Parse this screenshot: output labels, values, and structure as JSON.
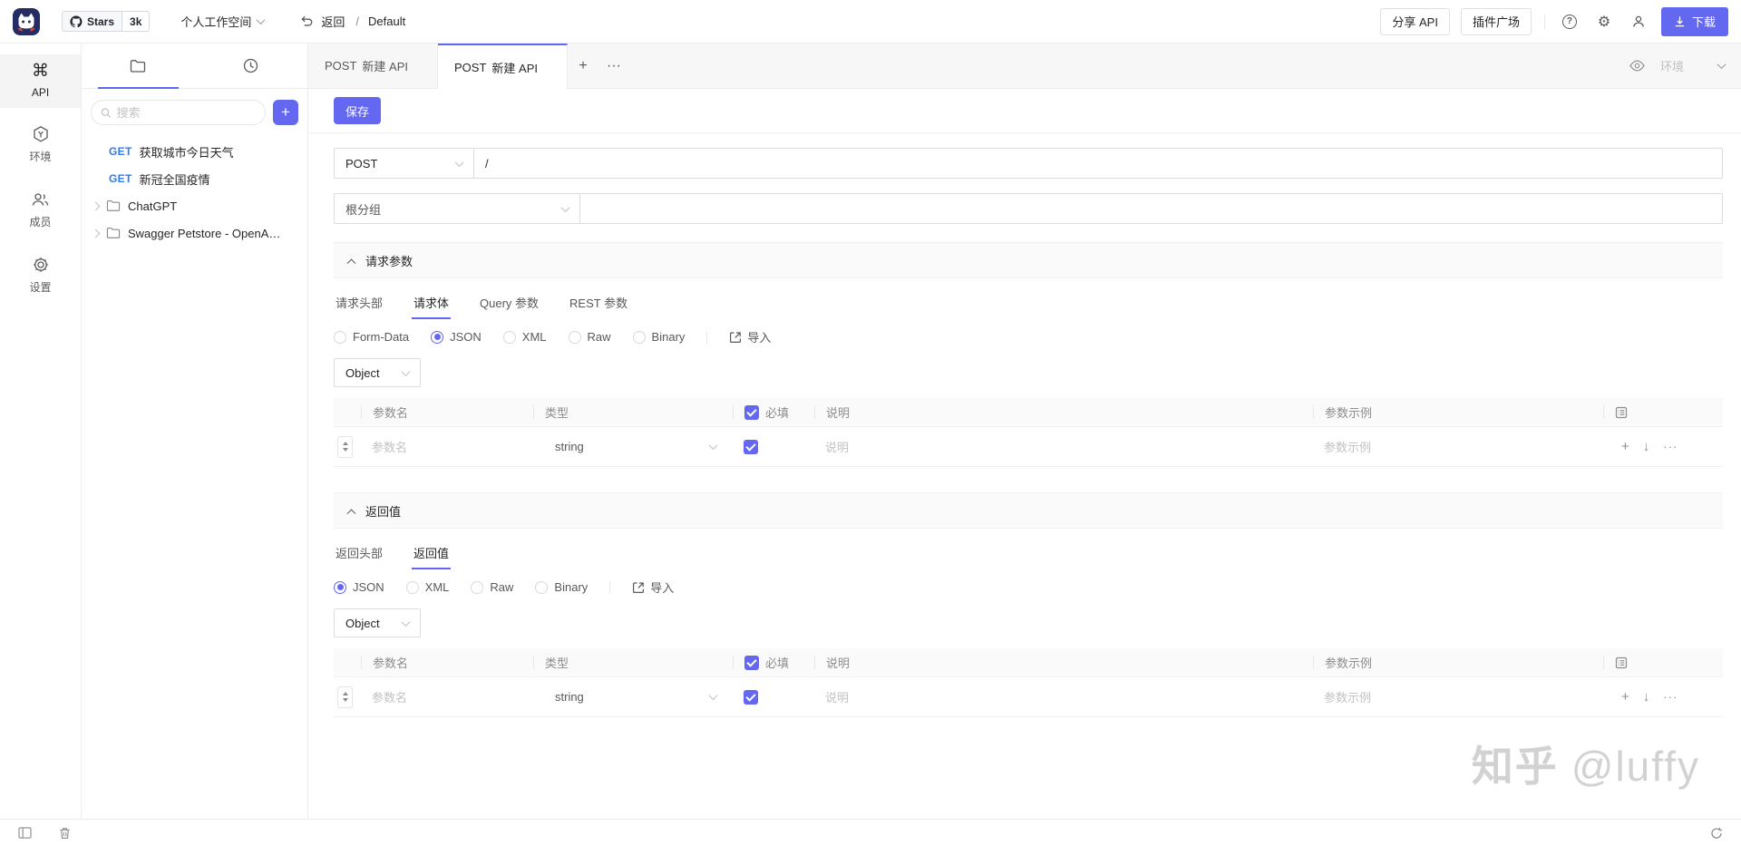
{
  "accent_color": "#6467ef",
  "get_color": "#2d7bf7",
  "topbar": {
    "stars_label": "Stars",
    "stars_count": "3k",
    "workspace": "个人工作空间",
    "back_label": "返回",
    "path_separator": "/",
    "project_name": "Default",
    "share_api_label": "分享 API",
    "plugin_market_label": "插件广场",
    "download_label": "下载"
  },
  "rail": {
    "items": [
      {
        "label": "API"
      },
      {
        "label": "环境"
      },
      {
        "label": "成员"
      },
      {
        "label": "设置"
      }
    ]
  },
  "sidebar": {
    "search_placeholder": "搜索",
    "add_button_label": "+",
    "items": [
      {
        "method": "GET",
        "name": "获取城市今日天气"
      },
      {
        "method": "GET",
        "name": "新冠全国疫情"
      },
      {
        "type": "folder",
        "name": "ChatGPT"
      },
      {
        "type": "folder",
        "name": "Swagger Petstore - OpenAPI ..."
      }
    ]
  },
  "tabbar": {
    "tabs": [
      {
        "method": "POST",
        "name": "新建 API"
      },
      {
        "method": "POST",
        "name": "新建 API"
      }
    ],
    "add_label": "+",
    "more_label": "···",
    "env_label": "环境"
  },
  "editor": {
    "save_label": "保存",
    "method_value": "POST",
    "url_value": "/",
    "group_value": "根分组",
    "request": {
      "title": "请求参数",
      "tabs": [
        "请求头部",
        "请求体",
        "Query 参数",
        "REST 参数"
      ],
      "active_tab": "请求体",
      "body_types": [
        "Form-Data",
        "JSON",
        "XML",
        "Raw",
        "Binary"
      ],
      "selected_type": "JSON",
      "import_label": "导入",
      "root_type": "Object"
    },
    "response": {
      "title": "返回值",
      "tabs": [
        "返回头部",
        "返回值"
      ],
      "active_tab": "返回值",
      "body_types": [
        "JSON",
        "XML",
        "Raw",
        "Binary"
      ],
      "selected_type": "JSON",
      "import_label": "导入",
      "root_type": "Object"
    },
    "param_table": {
      "headers": {
        "name": "参数名",
        "type": "类型",
        "required": "必填",
        "description": "说明",
        "example": "参数示例"
      },
      "row": {
        "name_placeholder": "参数名",
        "type_value": "string",
        "required": true,
        "description_placeholder": "说明",
        "example_placeholder": "参数示例",
        "actions": [
          "+",
          "↓",
          "···"
        ]
      }
    }
  },
  "watermark": {
    "brand": "知乎",
    "user": "@luffy"
  }
}
